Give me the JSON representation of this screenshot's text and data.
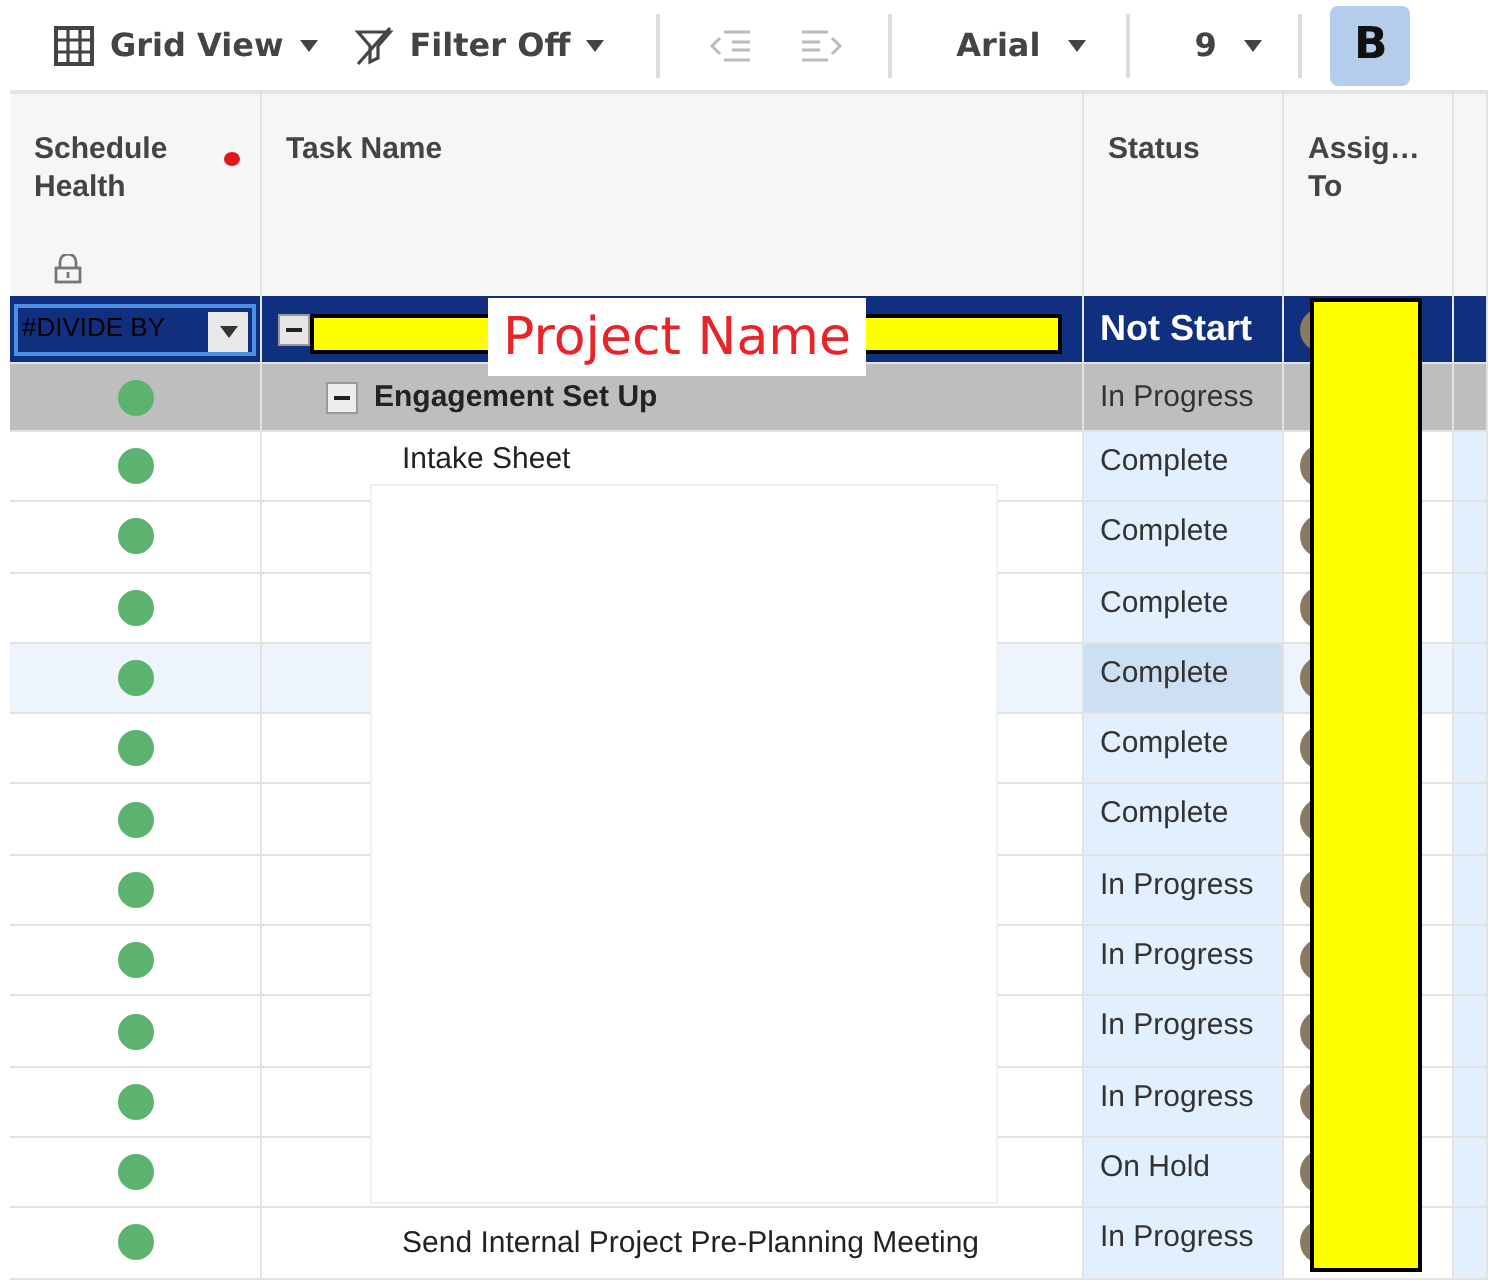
{
  "toolbar": {
    "view": "Grid View",
    "filter": "Filter Off",
    "font": "Arial",
    "size": "9",
    "bold": {
      "label": "B",
      "selected": true
    }
  },
  "columns": [
    "Schedule Health",
    "Task Name",
    "Status",
    "Assig… To"
  ],
  "health_alert": {
    "color": "#e0161c"
  },
  "project": {
    "health": "#DIVIDE BY",
    "label": "Project Name",
    "status": "Not Start"
  },
  "group": {
    "task": "Engagement Set Up",
    "status": "In Progress",
    "expanded": true,
    "color": "#5cb370"
  },
  "rows": [
    {
      "task": "Intake Sheet",
      "status": "Complete",
      "color": "#5cb370",
      "selected": false
    },
    {
      "status": "Complete",
      "color": "#5cb370",
      "selected": false
    },
    {
      "status": "Complete",
      "color": "#5cb370",
      "selected": false
    },
    {
      "status": "Complete",
      "color": "#5cb370",
      "selected": true
    },
    {
      "status": "Complete",
      "color": "#5cb370",
      "selected": false
    },
    {
      "status": "Complete",
      "color": "#5cb370",
      "selected": false
    },
    {
      "status": "In Progress",
      "color": "#5cb370",
      "selected": false
    },
    {
      "status": "In Progress",
      "color": "#5cb370",
      "selected": false
    },
    {
      "status": "In Progress",
      "color": "#5cb370",
      "selected": false
    },
    {
      "status": "In Progress",
      "color": "#5cb370",
      "selected": false
    },
    {
      "status": "On Hold",
      "color": "#5cb370",
      "selected": false
    },
    {
      "task": "Send Internal Project Pre-Planning Meeting",
      "status": "In Progress",
      "color": "#5cb370",
      "selected": false
    }
  ]
}
